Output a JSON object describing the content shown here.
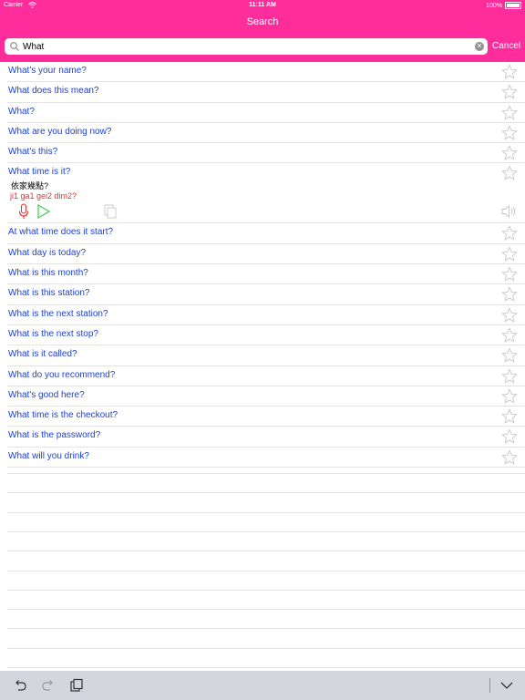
{
  "status_bar": {
    "carrier": "Carrier",
    "time": "11:11 AM",
    "battery": "100%"
  },
  "nav": {
    "title": "Search"
  },
  "search": {
    "value": "What",
    "cancel_label": "Cancel"
  },
  "colors": {
    "accent": "#ff2d9b",
    "link": "#1a3fd6",
    "romanization": "#e8302a",
    "mic": "#e8302a",
    "play": "#3ccf4e"
  },
  "results_before": [
    "What's your name?",
    "What does this mean?",
    "What?",
    "What are you doing now?",
    "What's this?"
  ],
  "expanded": {
    "english": "What time is it?",
    "chinese": "依家幾點?",
    "romanization": "ji1 ga1 gei2 dim2?"
  },
  "results_after": [
    "At what time does it start?",
    "What day is today?",
    "What is this month?",
    "What is this station?",
    "What is the next station?",
    "What is the next stop?",
    "What is it called?",
    "What do you recommend?",
    "What's good here?",
    "What time is the checkout?",
    "What is the password?",
    "What will you drink?"
  ],
  "icons": {
    "row": "star-icon",
    "expanded": [
      "microphone-icon",
      "play-icon",
      "copy-icon",
      "speaker-icon"
    ],
    "toolbar": [
      "undo-icon",
      "redo-icon",
      "paste-icon",
      "keyboard-dismiss-icon"
    ]
  }
}
